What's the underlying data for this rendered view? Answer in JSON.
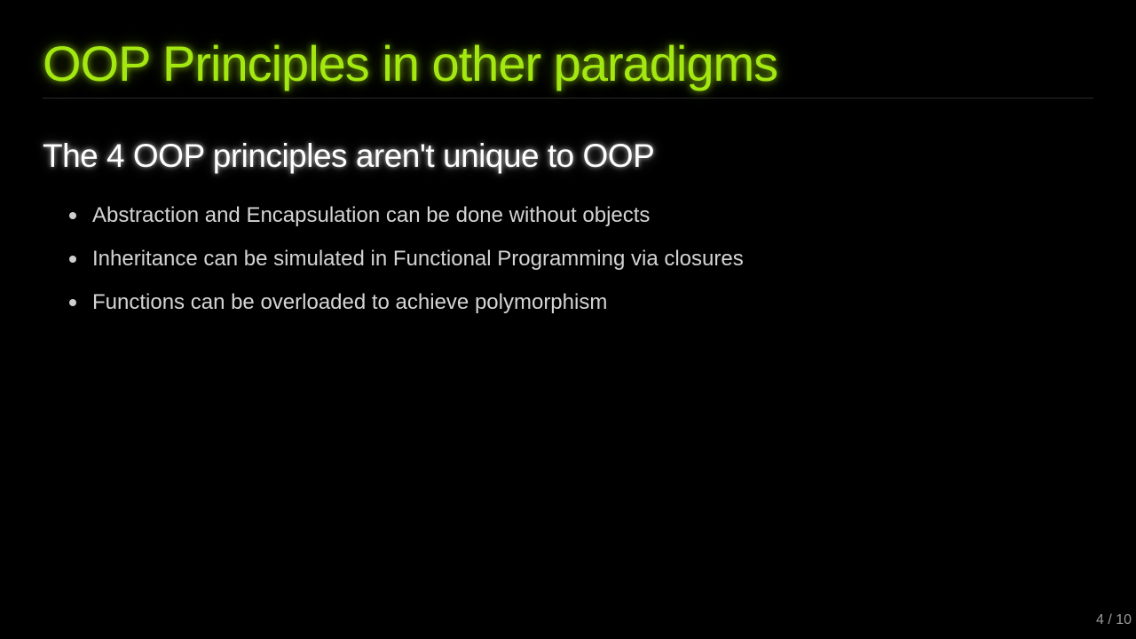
{
  "slide": {
    "title": "OOP Principles in other paradigms",
    "subtitle": "The 4 OOP principles aren't unique to OOP",
    "bullets": [
      "Abstraction and Encapsulation can be done without objects",
      "Inheritance can be simulated in Functional Programming via closures",
      "Functions can be overloaded to achieve polymorphism"
    ],
    "page_number": "4 / 10"
  },
  "colors": {
    "background": "#000000",
    "title": "#a4e812",
    "subtitle": "#ffffff",
    "bullet_text": "#d4d4d4",
    "page_number": "#9a9a9a"
  }
}
